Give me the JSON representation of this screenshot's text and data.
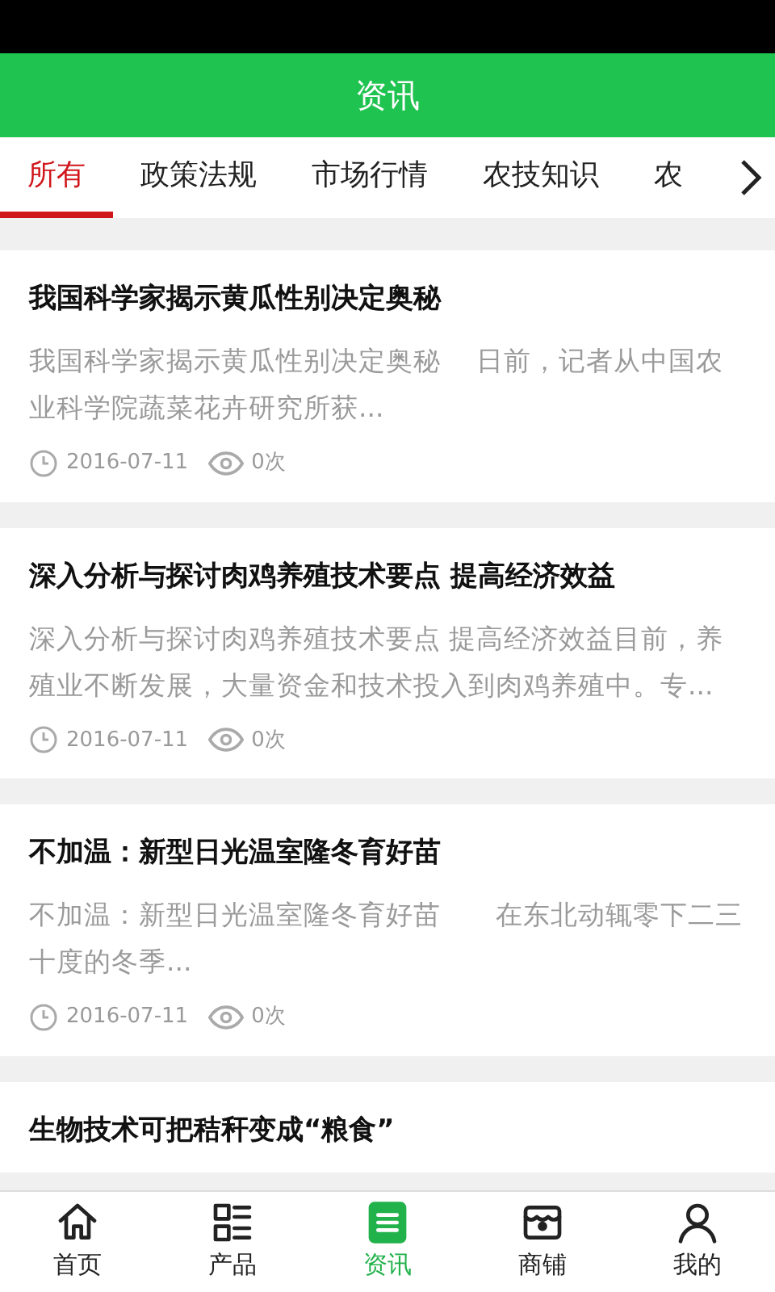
{
  "header": {
    "title": "资讯"
  },
  "tabs": [
    {
      "label": "所有",
      "selected": true
    },
    {
      "label": "政策法规",
      "selected": false
    },
    {
      "label": "市场行情",
      "selected": false
    },
    {
      "label": "农技知识",
      "selected": false
    },
    {
      "label": "农",
      "selected": false
    }
  ],
  "articles": [
    {
      "title": "我国科学家揭示黄瓜性别决定奥秘",
      "summary": "我国科学家揭示黄瓜性别决定奥秘　 日前，记者从中国农业科学院蔬菜花卉研究所获...",
      "date": "2016-07-11",
      "views": "0次"
    },
    {
      "title": "深入分析与探讨肉鸡养殖技术要点 提高经济效益",
      "summary": "深入分析与探讨肉鸡养殖技术要点 提高经济效益目前，养殖业不断发展，大量资金和技术投入到肉鸡养殖中。专...",
      "date": "2016-07-11",
      "views": "0次"
    },
    {
      "title": "不加温：新型日光温室隆冬育好苗",
      "summary": "不加温：新型日光温室隆冬育好苗　　在东北动辄零下二三十度的冬季...",
      "date": "2016-07-11",
      "views": "0次"
    },
    {
      "title": "生物技术可把秸秆变成“粮食”"
    }
  ],
  "bottom_nav": [
    {
      "kind": "home",
      "label": "首页",
      "selected": false
    },
    {
      "kind": "list",
      "label": "产品",
      "selected": false
    },
    {
      "kind": "news",
      "label": "资讯",
      "selected": true
    },
    {
      "kind": "shop",
      "label": "商铺",
      "selected": false
    },
    {
      "kind": "user",
      "label": "我的",
      "selected": false
    }
  ]
}
